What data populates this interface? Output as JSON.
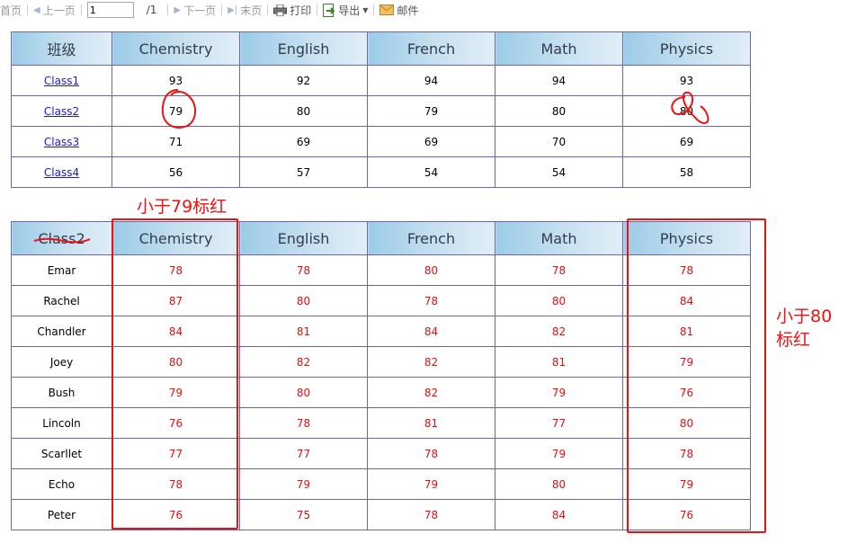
{
  "toolbar": {
    "first_label": "首页",
    "prev_label": "上一页",
    "page_value": "1",
    "page_total": "/1",
    "next_label": "下一页",
    "last_label": "末页",
    "print_label": "打印",
    "export_label": "导出",
    "mail_label": "邮件"
  },
  "table1": {
    "headers": [
      "班级",
      "Chemistry",
      "English",
      "French",
      "Math",
      "Physics"
    ],
    "rows": [
      {
        "name": "Class1",
        "values": [
          "93",
          "92",
          "94",
          "94",
          "93"
        ]
      },
      {
        "name": "Class2",
        "values": [
          "79",
          "80",
          "79",
          "80",
          "80"
        ]
      },
      {
        "name": "Class3",
        "values": [
          "71",
          "69",
          "69",
          "70",
          "69"
        ]
      },
      {
        "name": "Class4",
        "values": [
          "56",
          "57",
          "54",
          "54",
          "58"
        ]
      }
    ]
  },
  "table2": {
    "headers": [
      "Class2",
      "Chemistry",
      "English",
      "French",
      "Math",
      "Physics"
    ],
    "rows": [
      {
        "name": "Emar",
        "values": [
          "78",
          "78",
          "80",
          "78",
          "78"
        ]
      },
      {
        "name": "Rachel",
        "values": [
          "87",
          "80",
          "78",
          "80",
          "84"
        ]
      },
      {
        "name": "Chandler",
        "values": [
          "84",
          "81",
          "84",
          "82",
          "81"
        ]
      },
      {
        "name": "Joey",
        "values": [
          "80",
          "82",
          "82",
          "81",
          "79"
        ]
      },
      {
        "name": "Bush",
        "values": [
          "79",
          "80",
          "82",
          "79",
          "76"
        ]
      },
      {
        "name": "Lincoln",
        "values": [
          "76",
          "78",
          "81",
          "77",
          "80"
        ]
      },
      {
        "name": "Scarllet",
        "values": [
          "77",
          "77",
          "78",
          "79",
          "78"
        ]
      },
      {
        "name": "Echo",
        "values": [
          "78",
          "79",
          "79",
          "80",
          "79"
        ]
      },
      {
        "name": "Peter",
        "values": [
          "76",
          "75",
          "78",
          "84",
          "76"
        ]
      }
    ]
  },
  "annotations": {
    "note_chemistry": "小于79标红",
    "note_physics": "小于80\n标红",
    "color": "#ee1111"
  }
}
